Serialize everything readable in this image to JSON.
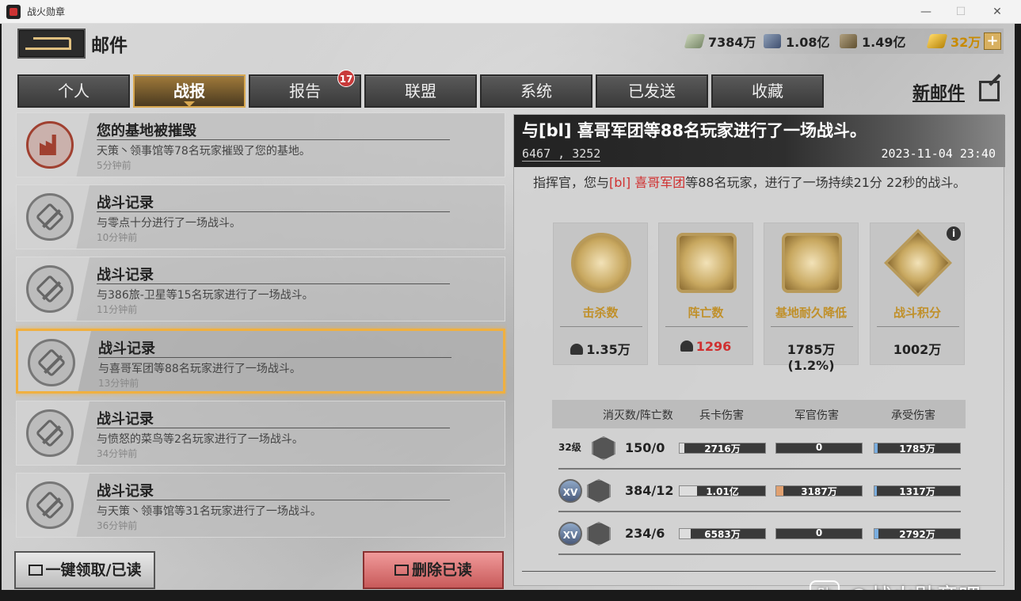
{
  "window": {
    "title": "战火勋章",
    "min": "—",
    "max": "☐",
    "close": "✕"
  },
  "header": {
    "title": "邮件"
  },
  "resources": [
    {
      "icon": "cash-icon",
      "value": "7384万"
    },
    {
      "icon": "steel-icon",
      "value": "1.08亿"
    },
    {
      "icon": "fuel-icon",
      "value": "1.49亿"
    },
    {
      "icon": "gold-icon",
      "value": "32万"
    }
  ],
  "plus_label": "+",
  "tabs": [
    {
      "label": "个人",
      "active": false
    },
    {
      "label": "战报",
      "active": true
    },
    {
      "label": "报告",
      "active": false,
      "badge": "17"
    },
    {
      "label": "联盟",
      "active": false
    },
    {
      "label": "系统",
      "active": false
    },
    {
      "label": "已发送",
      "active": false
    },
    {
      "label": "收藏",
      "active": false
    }
  ],
  "new_mail_label": "新邮件",
  "mails": [
    {
      "icon": "destroyed-base-icon",
      "title": "您的基地被摧毁",
      "desc": "天策丶领事馆等78名玩家摧毁了您的基地。",
      "time": "5分钟前"
    },
    {
      "icon": "crossed-guns-icon",
      "title": "战斗记录",
      "desc": "与零点十分进行了一场战斗。",
      "time": "10分钟前"
    },
    {
      "icon": "crossed-guns-icon",
      "title": "战斗记录",
      "desc": "与386旅-卫星等15名玩家进行了一场战斗。",
      "time": "11分钟前"
    },
    {
      "icon": "crossed-guns-icon",
      "title": "战斗记录",
      "desc": "与喜哥军团等88名玩家进行了一场战斗。",
      "time": "13分钟前",
      "selected": true
    },
    {
      "icon": "crossed-guns-icon",
      "title": "战斗记录",
      "desc": "与愤怒的菜鸟等2名玩家进行了一场战斗。",
      "time": "34分钟前"
    },
    {
      "icon": "crossed-guns-icon",
      "title": "战斗记录",
      "desc": "与天策丶领事馆等31名玩家进行了一场战斗。",
      "time": "36分钟前"
    }
  ],
  "buttons": {
    "claim": "一键领取/已读",
    "delete": "删除已读"
  },
  "detail": {
    "title": "与[bl] 喜哥军团等88名玩家进行了一场战斗。",
    "coords": "6467 , 3252",
    "datetime": "2023-11-04 23:40",
    "summary_prefix": "指挥官，您与",
    "summary_highlight": "[bl] 喜哥军团",
    "summary_suffix": "等88名玩家，进行了一场持续21分 22秒的战斗。",
    "stats": [
      {
        "label": "击杀数",
        "value": "1.35万"
      },
      {
        "label": "阵亡数",
        "value": "1296"
      },
      {
        "label": "基地耐久降低",
        "value": "1785万(1.2%)"
      },
      {
        "label": "战斗积分",
        "value": "1002万"
      }
    ],
    "table_headers": [
      "消灭数/阵亡数",
      "兵卡伤害",
      "军官伤害",
      "承受伤害"
    ],
    "rows": [
      {
        "level": "32级",
        "kd": "150/0",
        "troop": "2716万",
        "troop_frac": 0.06,
        "officer": "0",
        "officer_frac": 0,
        "taken": "1785万",
        "taken_frac": 0.04
      },
      {
        "rank": "XV",
        "kd": "384/12",
        "troop": "1.01亿",
        "troop_frac": 0.2,
        "officer": "3187万",
        "officer_frac": 0.08,
        "taken": "1317万",
        "taken_frac": 0.03
      },
      {
        "rank": "XV",
        "kd": "234/6",
        "troop": "6583万",
        "troop_frac": 0.13,
        "officer": "0",
        "officer_frac": 0,
        "taken": "2792万",
        "taken_frac": 0.05
      }
    ]
  },
  "watermark": {
    "logo": "贴",
    "text": "@战火勋章吧"
  },
  "colors": {
    "accent_gold": "#d8a850",
    "highlight_red": "#d03030",
    "selected_border": "#f0b040"
  }
}
